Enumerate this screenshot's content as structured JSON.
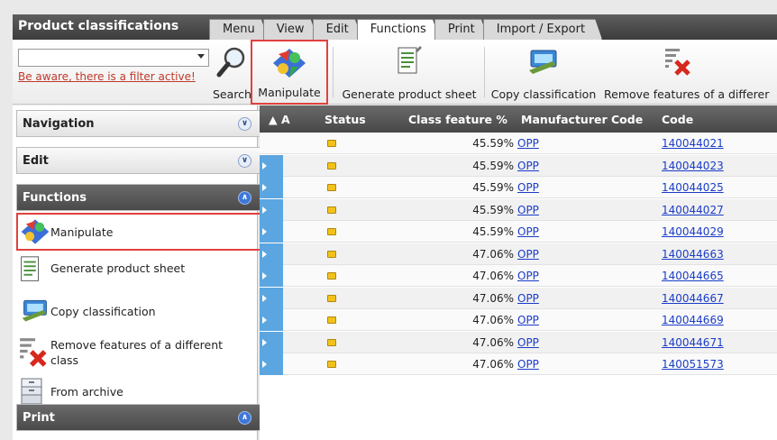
{
  "app": {
    "title": "Product classifications"
  },
  "tabs": [
    {
      "label": "Menu"
    },
    {
      "label": "View"
    },
    {
      "label": "Edit"
    },
    {
      "label": "Functions",
      "active": true
    },
    {
      "label": "Print"
    },
    {
      "label": "Import / Export"
    }
  ],
  "toolbar": {
    "filter_warning": "Be aware, there is a filter active!",
    "search_label": "Search",
    "manipulate_label": "Manipulate",
    "generate_label": "Generate product sheet",
    "copy_label": "Copy classification",
    "remove_label": "Remove features of a differer"
  },
  "sidebar": {
    "navigation": "Navigation",
    "edit": "Edit",
    "functions": "Functions",
    "print": "Print",
    "items": [
      {
        "label": "Manipulate",
        "icon": "manipulate-icon"
      },
      {
        "label": "Generate product sheet",
        "icon": "product-sheet-icon"
      },
      {
        "label": "Copy classification",
        "icon": "copy-classification-icon"
      },
      {
        "label": "Remove features of a different class",
        "icon": "remove-features-icon"
      },
      {
        "label": "From archive",
        "icon": "archive-icon"
      }
    ]
  },
  "grid": {
    "columns": {
      "sort": "▲ A",
      "status": "Status",
      "pct": "Class feature %",
      "manufacturer": "Manufacturer Code",
      "code": "Code"
    },
    "rows": [
      {
        "pct": "45.59%",
        "mfr": "OPP",
        "code": "140044021"
      },
      {
        "pct": "45.59%",
        "mfr": "OPP",
        "code": "140044023"
      },
      {
        "pct": "45.59%",
        "mfr": "OPP",
        "code": "140044025"
      },
      {
        "pct": "45.59%",
        "mfr": "OPP",
        "code": "140044027"
      },
      {
        "pct": "45.59%",
        "mfr": "OPP",
        "code": "140044029"
      },
      {
        "pct": "47.06%",
        "mfr": "OPP",
        "code": "140044663"
      },
      {
        "pct": "47.06%",
        "mfr": "OPP",
        "code": "140044665"
      },
      {
        "pct": "47.06%",
        "mfr": "OPP",
        "code": "140044667"
      },
      {
        "pct": "47.06%",
        "mfr": "OPP",
        "code": "140044669"
      },
      {
        "pct": "47.06%",
        "mfr": "OPP",
        "code": "140044671"
      },
      {
        "pct": "47.06%",
        "mfr": "OPP",
        "code": "140051573"
      }
    ]
  }
}
